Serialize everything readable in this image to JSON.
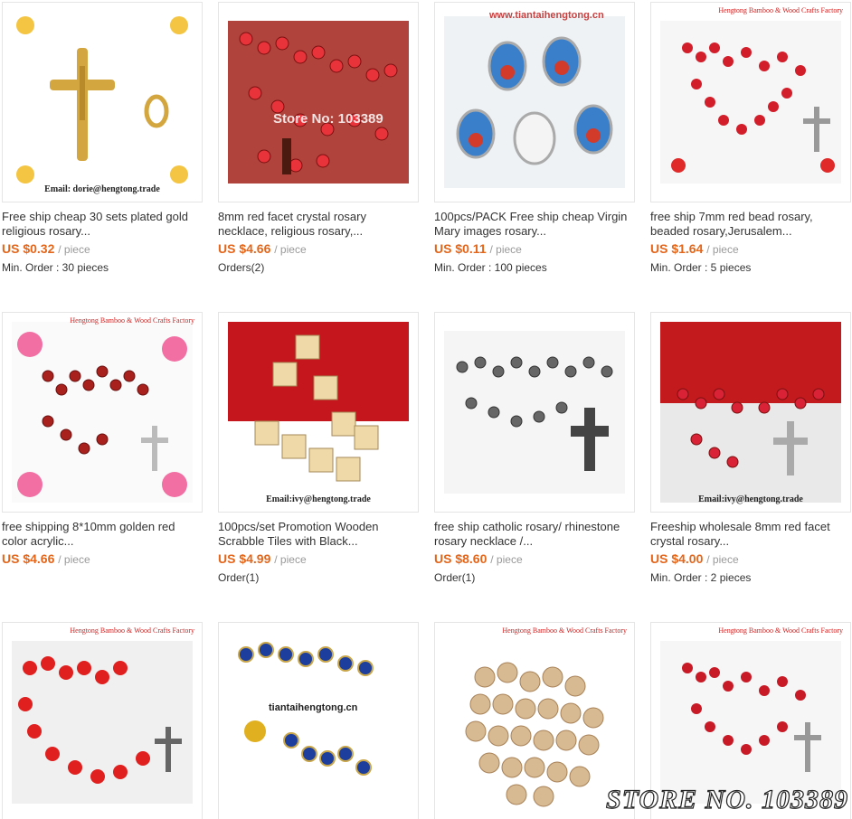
{
  "products": [
    {
      "title": "Free ship cheap 30 sets plated gold religious rosary...",
      "price": "US $0.32",
      "unit": "/ piece",
      "meta": "Min. Order : 30 pieces",
      "image_caption": "Email: dorie@hengtong.trade",
      "image_icon": "gold-crucifix-icon"
    },
    {
      "title": "8mm red facet crystal rosary necklace, religious rosary,...",
      "price": "US $4.66",
      "unit": "/ piece",
      "meta": "Orders(2)",
      "image_store": "Store No: 103389",
      "image_icon": "red-crystal-rosary-icon"
    },
    {
      "title": "100pcs/PACK Free ship cheap Virgin Mary images rosary...",
      "price": "US $0.11",
      "unit": "/ piece",
      "meta": "Min. Order : 100 pieces",
      "image_store": "www.tiantaihengtong.cn",
      "image_icon": "virgin-mary-medal-icon"
    },
    {
      "title": "free ship 7mm red bead rosary, beaded rosary,Jerusalem...",
      "price": "US $1.64",
      "unit": "/ piece",
      "meta": "Min. Order : 5 pieces",
      "image_factory": "Hengtong Bamboo & Wood Crafts Factory",
      "image_icon": "red-bead-rosary-icon"
    },
    {
      "title": "free shipping 8*10mm golden red color acrylic...",
      "price": "US $4.66",
      "unit": "/ piece",
      "meta": "",
      "image_factory": "Hengtong Bamboo & Wood Crafts Factory",
      "image_icon": "golden-red-rosary-icon"
    },
    {
      "title": "100pcs/set Promotion Wooden Scrabble Tiles with Black...",
      "price": "US $4.99",
      "unit": "/ piece",
      "meta": "Order(1)",
      "image_caption": "Email:ivy@hengtong.trade",
      "image_icon": "scrabble-tiles-icon"
    },
    {
      "title": "free ship catholic rosary/ rhinestone rosary necklace /...",
      "price": "US $8.60",
      "unit": "/ piece",
      "meta": "Order(1)",
      "image_icon": "rhinestone-rosary-icon"
    },
    {
      "title": "Freeship wholesale 8mm red facet crystal rosary...",
      "price": "US $4.00",
      "unit": "/ piece",
      "meta": "Min. Order : 2 pieces",
      "image_caption": "Email:ivy@hengtong.trade",
      "image_icon": "red-facet-rosary-icon"
    },
    {
      "title": "",
      "price": "",
      "unit": "",
      "meta": "",
      "image_factory": "Hengtong Bamboo & Wood Crafts Factory",
      "image_icon": "red-rose-rosary-icon"
    },
    {
      "title": "",
      "price": "",
      "unit": "",
      "meta": "",
      "image_store": "tiantaihengtong.cn",
      "image_icon": "cloisonne-rosary-icon"
    },
    {
      "title": "",
      "price": "",
      "unit": "",
      "meta": "",
      "image_factory": "Hengtong Bamboo & Wood Crafts Factory",
      "image_icon": "wooden-beads-icon"
    },
    {
      "title": "",
      "price": "",
      "unit": "",
      "meta": "",
      "image_factory": "Hengtong Bamboo & Wood Crafts Factory",
      "image_icon": "red-bead-rosary-icon"
    }
  ],
  "watermark": "STORE NO. 103389",
  "colors": {
    "price": "#e4661b",
    "unit": "#999999",
    "border": "#e5e5e5"
  }
}
